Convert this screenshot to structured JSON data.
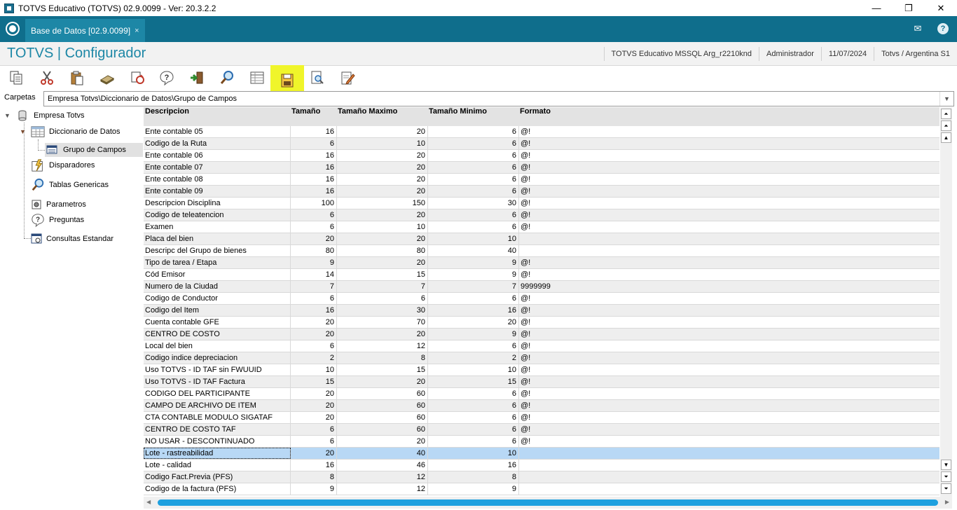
{
  "window": {
    "title": "TOTVS Educativo (TOTVS) 02.9.0099 - Ver: 20.3.2.2",
    "minimize": "—",
    "maximize": "❐",
    "close": "✕"
  },
  "tabbar": {
    "tab_label": "Base de Datos [02.9.0099]",
    "tab_close": "×",
    "mail_icon": "✉",
    "help_icon": "?"
  },
  "header": {
    "app_title": "TOTVS | Configurador",
    "environment": "TOTVS Educativo MSSQL Arg_r2210knd",
    "user": "Administrador",
    "date": "11/07/2024",
    "company": "Totvs / Argentina S1"
  },
  "toolbar": {
    "icons": [
      "copy-icon",
      "cut-icon",
      "paste-icon",
      "book-icon",
      "refresh-icon",
      "help-icon",
      "exit-icon",
      "search-icon",
      "grid-icon",
      "save-icon",
      "preview-icon",
      "edit-icon"
    ],
    "active": "save-icon"
  },
  "carpetas": {
    "label": "Carpetas",
    "path": "Empresa Totvs\\Diccionario de Datos\\Grupo de Campos"
  },
  "tree": {
    "root": "Empresa Totvs",
    "diccionario": "Diccionario de Datos",
    "grupo": "Grupo de Campos",
    "disparadores": "Disparadores",
    "tablas": "Tablas Genericas",
    "parametros": "Parametros",
    "preguntas": "Preguntas",
    "consultas": "Consultas Estandar"
  },
  "grid": {
    "headers": [
      "Descripcion",
      "Tamaño",
      "Tamaño Maximo",
      "Tamaño Minimo",
      "Formato"
    ],
    "selected_index": 27,
    "rows": [
      [
        "Ente contable 05",
        "16",
        "20",
        "6",
        "@!"
      ],
      [
        "Codigo de la Ruta",
        "6",
        "10",
        "6",
        "@!"
      ],
      [
        "Ente contable 06",
        "16",
        "20",
        "6",
        "@!"
      ],
      [
        "Ente contable 07",
        "16",
        "20",
        "6",
        "@!"
      ],
      [
        "Ente contable 08",
        "16",
        "20",
        "6",
        "@!"
      ],
      [
        "Ente contable 09",
        "16",
        "20",
        "6",
        "@!"
      ],
      [
        "Descripcion Disciplina",
        "100",
        "150",
        "30",
        "@!"
      ],
      [
        "Codigo de teleatencion",
        "6",
        "20",
        "6",
        "@!"
      ],
      [
        "Examen",
        "6",
        "10",
        "6",
        "@!"
      ],
      [
        "Placa del bien",
        "20",
        "20",
        "10",
        ""
      ],
      [
        "Descripc del Grupo de bienes",
        "80",
        "80",
        "40",
        ""
      ],
      [
        "Tipo de tarea / Etapa",
        "9",
        "20",
        "9",
        "@!"
      ],
      [
        "Cód Emisor",
        "14",
        "15",
        "9",
        "@!"
      ],
      [
        "Numero de la Ciudad",
        "7",
        "7",
        "7",
        "9999999"
      ],
      [
        "Codigo de Conductor",
        "6",
        "6",
        "6",
        "@!"
      ],
      [
        "Codigo del Item",
        "16",
        "30",
        "16",
        "@!"
      ],
      [
        "Cuenta contable GFE",
        "20",
        "70",
        "20",
        "@!"
      ],
      [
        "CENTRO DE COSTO",
        "20",
        "20",
        "9",
        "@!"
      ],
      [
        "Local del bien",
        "6",
        "12",
        "6",
        "@!"
      ],
      [
        "Codigo indice depreciacion",
        "2",
        "8",
        "2",
        "@!"
      ],
      [
        "Uso TOTVS - ID TAF sin FWUUID",
        "10",
        "15",
        "10",
        "@!"
      ],
      [
        "Uso TOTVS - ID TAF Factura",
        "15",
        "20",
        "15",
        "@!"
      ],
      [
        "CODIGO DEL PARTICIPANTE",
        "20",
        "60",
        "6",
        "@!"
      ],
      [
        "CAMPO DE ARCHIVO DE ITEM",
        "20",
        "60",
        "6",
        "@!"
      ],
      [
        "CTA CONTABLE MODULO SIGATAF",
        "20",
        "60",
        "6",
        "@!"
      ],
      [
        "CENTRO DE COSTO TAF",
        "6",
        "60",
        "6",
        "@!"
      ],
      [
        "NO USAR - DESCONTINUADO",
        "6",
        "20",
        "6",
        "@!"
      ],
      [
        "Lote - rastreabilidad",
        "20",
        "40",
        "10",
        ""
      ],
      [
        "Lote - calidad",
        "16",
        "46",
        "16",
        ""
      ],
      [
        "Codigo Fact.Previa (PFS)",
        "8",
        "12",
        "8",
        ""
      ],
      [
        "Codigo de la factura (PFS)",
        "9",
        "12",
        "9",
        ""
      ]
    ]
  }
}
